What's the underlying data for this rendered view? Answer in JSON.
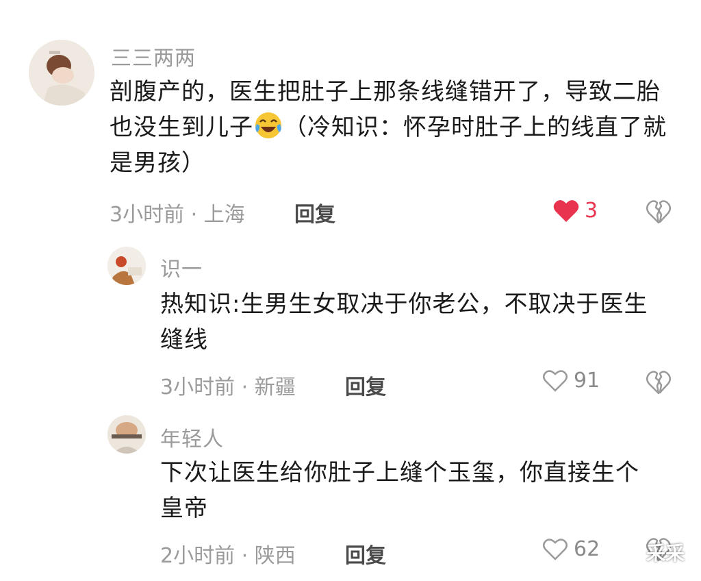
{
  "comments": [
    {
      "username": "三三两两",
      "content": "剖腹产的，医生把肚子上那条线缝错开了，导致二胎也没生到儿子",
      "content_after_emoji": "（冷知识：怀孕时肚子上的线直了就是男孩）",
      "emoji": "laughing-tears-emoji",
      "meta": "3小时前 · 上海",
      "reply_label": "回复",
      "likes": "3",
      "liked": true
    },
    {
      "username": "识一",
      "content": "热知识:生男生女取决于你老公，不取决于医生缝线",
      "meta": "3小时前 · 新疆",
      "reply_label": "回复",
      "likes": "91",
      "liked": false
    },
    {
      "username": "年轻人",
      "content": "下次让医生给你肚子上缝个玉玺，你直接生个皇帝",
      "meta": "2小时前 · 陕西",
      "reply_label": "回复",
      "likes": "62",
      "liked": false
    }
  ],
  "watermark": {
    "text": "采采"
  },
  "colors": {
    "like_active": "#e8344e",
    "muted": "#9a9a9a",
    "text": "#1a1a1a"
  }
}
